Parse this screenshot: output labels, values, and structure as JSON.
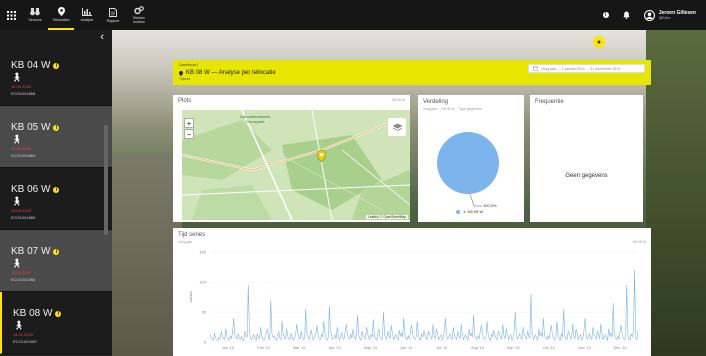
{
  "topbar": {
    "nav": [
      {
        "label": "Sensors",
        "icon": "binoculars-icon"
      },
      {
        "label": "Tellocaties",
        "icon": "map-pin-icon"
      },
      {
        "label": "Analyse",
        "icon": "bar-chart-icon"
      },
      {
        "label": "Rapport",
        "icon": "document-icon"
      },
      {
        "label": "Beheer\ntoolbox",
        "icon": "gears-icon"
      }
    ],
    "user_name": "Jeroen Gillesen",
    "user_org": "@Echo"
  },
  "sidebar": {
    "items": [
      {
        "title": "KB 04 W",
        "date": "16.04.2020",
        "code": "ECO1001868"
      },
      {
        "title": "KB 05 W",
        "date": "16.04.2020",
        "code": "ECO1001869"
      },
      {
        "title": "KB 06 W",
        "date": "16.04.2020",
        "code": "ECO1001869"
      },
      {
        "title": "KB 07 W",
        "date": "14.01.2020",
        "code": "ECO1001865"
      },
      {
        "title": "KB 08 W",
        "date": "14.01.2020",
        "code": "ECO1001857"
      }
    ]
  },
  "header": {
    "crumb": "Dashboard",
    "title": "KB 08 W — Analyse per tellocatie",
    "subtitle": "Telpunt",
    "date_range": "Vorig jaar  —  1 januari 2019 — 31 december 2019"
  },
  "panels": {
    "plots_title": "Plots",
    "plots_tag": "KB 08 W",
    "verdeling_title": "Verdeling",
    "verdeling_sub1": "Vorig jaar",
    "verdeling_sub2": "KB 08 W",
    "verdeling_sub3": "Type gegevens",
    "percent": "100,0%",
    "legend": "1. KB 08 W",
    "frequentie_title": "Frequentie",
    "no_data": "Geen gegevens",
    "tijd_title": "Tijd series",
    "tijd_sub": "Vorig jaar",
    "tijd_tag": "KB 08 W",
    "map_label": "Natuurtelnetwerk\nGrenspark",
    "map_attr": "Leaflet | © OpenStreetMap"
  },
  "chart_data": {
    "type": "line",
    "title": "Tijd series",
    "ylabel": "Aantal",
    "ylim": [
      0,
      150
    ],
    "yticks": [
      0,
      50,
      100,
      150
    ],
    "categories": [
      "Jan '19",
      "Feb '19",
      "Mar '19",
      "Apr '19",
      "May '19",
      "Jun '19",
      "Jul '19",
      "Aug '19",
      "Sep '19",
      "Oct '19",
      "Nov '19",
      "Dec '19"
    ],
    "series": [
      {
        "name": "KB 08 W",
        "color": "#7cb5ec",
        "values": [
          12,
          8,
          5,
          3,
          15,
          6,
          4,
          2,
          8,
          5,
          18,
          10,
          6,
          4,
          22,
          8,
          5,
          3,
          10,
          6,
          15,
          40,
          12,
          8,
          5,
          14,
          6,
          4,
          9,
          3,
          2,
          18,
          12,
          8,
          95,
          20,
          6,
          4,
          8,
          12,
          5,
          3,
          14,
          8,
          6,
          25,
          10,
          5,
          3,
          8,
          15,
          22,
          6,
          4,
          70,
          14,
          8,
          10,
          5,
          3,
          12,
          18,
          6,
          4,
          35,
          12,
          8,
          5,
          22,
          10,
          6,
          4,
          15,
          8,
          3,
          6,
          12,
          30,
          14,
          8,
          5,
          18,
          10,
          4,
          6,
          55,
          14,
          8,
          4,
          12,
          20,
          6,
          3,
          8,
          15,
          28,
          10,
          5,
          4,
          12,
          8,
          35,
          14,
          6,
          3,
          8,
          60,
          18,
          10,
          4,
          6,
          12,
          5,
          25,
          8,
          3,
          10,
          15,
          6,
          4,
          18,
          30,
          12,
          8,
          5,
          14,
          6,
          22,
          10,
          4,
          8,
          45,
          12,
          6,
          3,
          18,
          10,
          8,
          5,
          25,
          14,
          6,
          4,
          12,
          8,
          38,
          10,
          5,
          3,
          14,
          22,
          8,
          6,
          4,
          50,
          12,
          8,
          5,
          18,
          10,
          6,
          28,
          14,
          4,
          8,
          12,
          6,
          3,
          20,
          10,
          15,
          8,
          40,
          12,
          6,
          4,
          10,
          5,
          18,
          28,
          12,
          6,
          4,
          8,
          35,
          12,
          5,
          3,
          14,
          8,
          20,
          10,
          6,
          4,
          18,
          12,
          8,
          5,
          30,
          10,
          6,
          22,
          14,
          4,
          8,
          12,
          3,
          6,
          18,
          40,
          10,
          5,
          8,
          14,
          6,
          4,
          25,
          12,
          8,
          5,
          18,
          10,
          6,
          30,
          14,
          4,
          8,
          12,
          6,
          3,
          22,
          10,
          15,
          8,
          45,
          12,
          6,
          4,
          10,
          5,
          18,
          28,
          12,
          6,
          4,
          8,
          35,
          12,
          5,
          3,
          14,
          8,
          20,
          10,
          6,
          4,
          18,
          12,
          8,
          5,
          30,
          10,
          6,
          22,
          14,
          4,
          8,
          12,
          3,
          6,
          18,
          50,
          10,
          5,
          8,
          14,
          6,
          4,
          25,
          12,
          8,
          5,
          18,
          10,
          6,
          80,
          14,
          4,
          8,
          12,
          6,
          3,
          22,
          10,
          15,
          8,
          40,
          12,
          6,
          4,
          10,
          5,
          18,
          28,
          12,
          6,
          4,
          8,
          35,
          12,
          5,
          3,
          14,
          8,
          55,
          10,
          6,
          4,
          18,
          12,
          8,
          5,
          30,
          10,
          6,
          22,
          14,
          4,
          8,
          12,
          3,
          6,
          18,
          40,
          10,
          5,
          8,
          14,
          6,
          4,
          25,
          12,
          8,
          5,
          18,
          10,
          6,
          30,
          14,
          4,
          8,
          12,
          6,
          3,
          22,
          10,
          15,
          8,
          65,
          12,
          6,
          4,
          10,
          5,
          18,
          28,
          12,
          6,
          4,
          8,
          95,
          12,
          5,
          3,
          14,
          8,
          20,
          120,
          6,
          4,
          18
        ]
      }
    ]
  }
}
